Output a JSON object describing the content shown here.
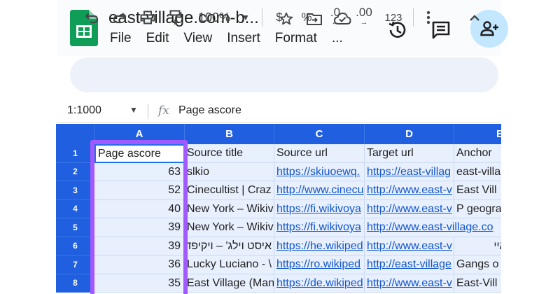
{
  "app": {
    "doc_title": "east-village.com-b...",
    "menu": [
      "File",
      "Edit",
      "View",
      "Insert",
      "Format",
      "..."
    ]
  },
  "toolbar": {
    "zoom": "100%",
    "currency": "$",
    "percent": "%",
    "dec_decrease": ".0",
    "dec_increase": ".00",
    "number_format": "123"
  },
  "formula_bar": {
    "name_box": "1:1000",
    "fx": "fx",
    "value": "Page ascore"
  },
  "sheet": {
    "columns": [
      "A",
      "B",
      "C",
      "D",
      "E"
    ],
    "rows": [
      {
        "n": "1",
        "a": "Page ascore",
        "b": "Source title",
        "c": "Source url",
        "d": "Target url",
        "e": "Anchor"
      },
      {
        "n": "2",
        "a": "63",
        "b": "slkio",
        "c": "https://skiuoewq.",
        "d": "https://east-villag",
        "e": "east-villa"
      },
      {
        "n": "3",
        "a": "52",
        "b": "Cinecultist | Craz",
        "c": "http://www.cinecu",
        "d": "http://www.east-v",
        "e": "East Vill"
      },
      {
        "n": "4",
        "a": "40",
        "b": "New York – Wikiv",
        "c": "https://fi.wikivoya",
        "d": "http://www.east-v",
        "e": "P geogra"
      },
      {
        "n": "5",
        "a": "39",
        "b": "New York – Wikiv",
        "c": "https://fi.wikivoya",
        "d": "http://www.east-village.co",
        "e": ""
      },
      {
        "n": "6",
        "a": "39",
        "b": "איסט וילג' – ויקיפד",
        "c": "https://he.wikiped",
        "d": "http://www.east-v",
        "e": "ה של האיי"
      },
      {
        "n": "7",
        "a": "36",
        "b": "Lucky Luciano - \\",
        "c": "https://ro.wikiped",
        "d": "http://east-village",
        "e": "Gangs o"
      },
      {
        "n": "8",
        "a": "35",
        "b": "East Village (Man",
        "c": "https://de.wikiped",
        "d": "http://www.east-v",
        "e": "East-Vill"
      }
    ]
  },
  "colors": {
    "header_blue": "#1f5fe0",
    "cell_tint": "#e8f0fe",
    "link": "#1155cc",
    "highlight": "#a259ff",
    "share_bg": "#c2e7ff"
  }
}
